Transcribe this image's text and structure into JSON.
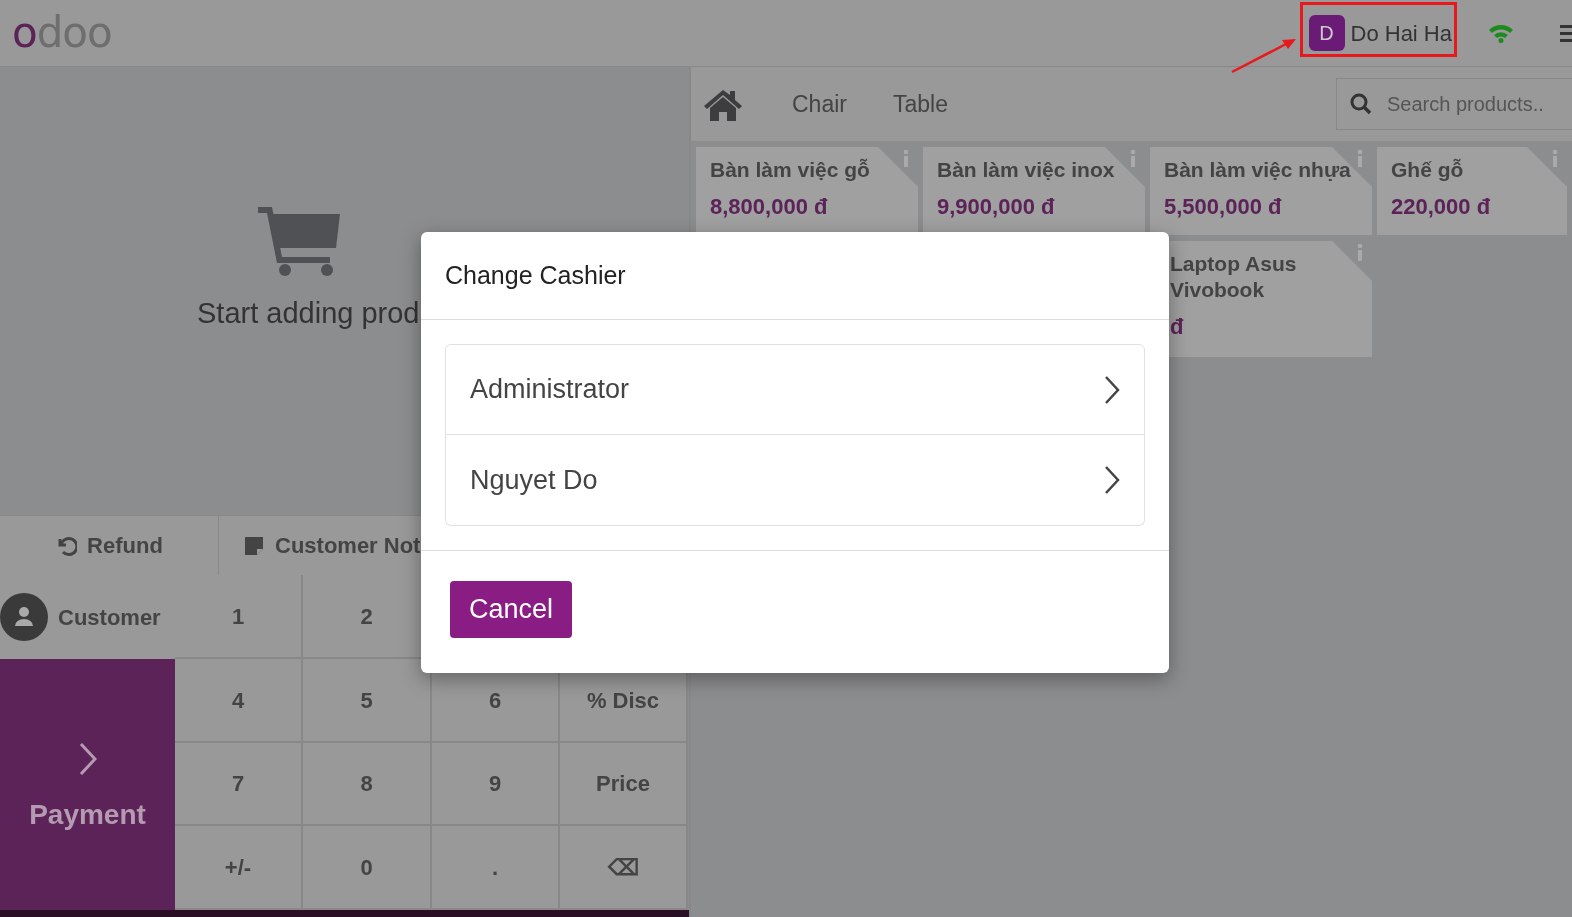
{
  "header": {
    "logo": "odoo",
    "cashier": {
      "initial": "D",
      "name": "Do Hai Ha"
    }
  },
  "categories": [
    {
      "label": "Chair"
    },
    {
      "label": "Table"
    }
  ],
  "search": {
    "placeholder": "Search products.."
  },
  "products": [
    {
      "name": "Bàn làm việc gỗ",
      "price": "8,800,000 đ"
    },
    {
      "name": "Bàn làm việc inox",
      "price": "9,900,000 đ"
    },
    {
      "name": "Bàn làm việc nhựa",
      "price": "5,500,000 đ"
    },
    {
      "name": "Ghế gỗ",
      "price": "220,000 đ"
    },
    {
      "name": "Laptop Asus Vivobook",
      "price": "đ"
    }
  ],
  "order": {
    "empty_text": "Start adding prod"
  },
  "control_buttons": [
    {
      "label": "Refund",
      "kind": "refund"
    },
    {
      "label": "Customer Not",
      "kind": "note"
    }
  ],
  "customer_button": {
    "label": "Customer"
  },
  "payment_button": {
    "label": "Payment"
  },
  "numpad": [
    [
      "1",
      "2"
    ],
    [
      "4",
      "5",
      "6",
      "% Disc"
    ],
    [
      "7",
      "8",
      "9",
      "Price"
    ],
    [
      "+/-",
      "0",
      ".",
      "⌫"
    ]
  ],
  "dialog": {
    "title": "Change Cashier",
    "cashiers": [
      {
        "name": "Administrator"
      },
      {
        "name": "Nguyet Do"
      }
    ],
    "cancel": "Cancel"
  }
}
